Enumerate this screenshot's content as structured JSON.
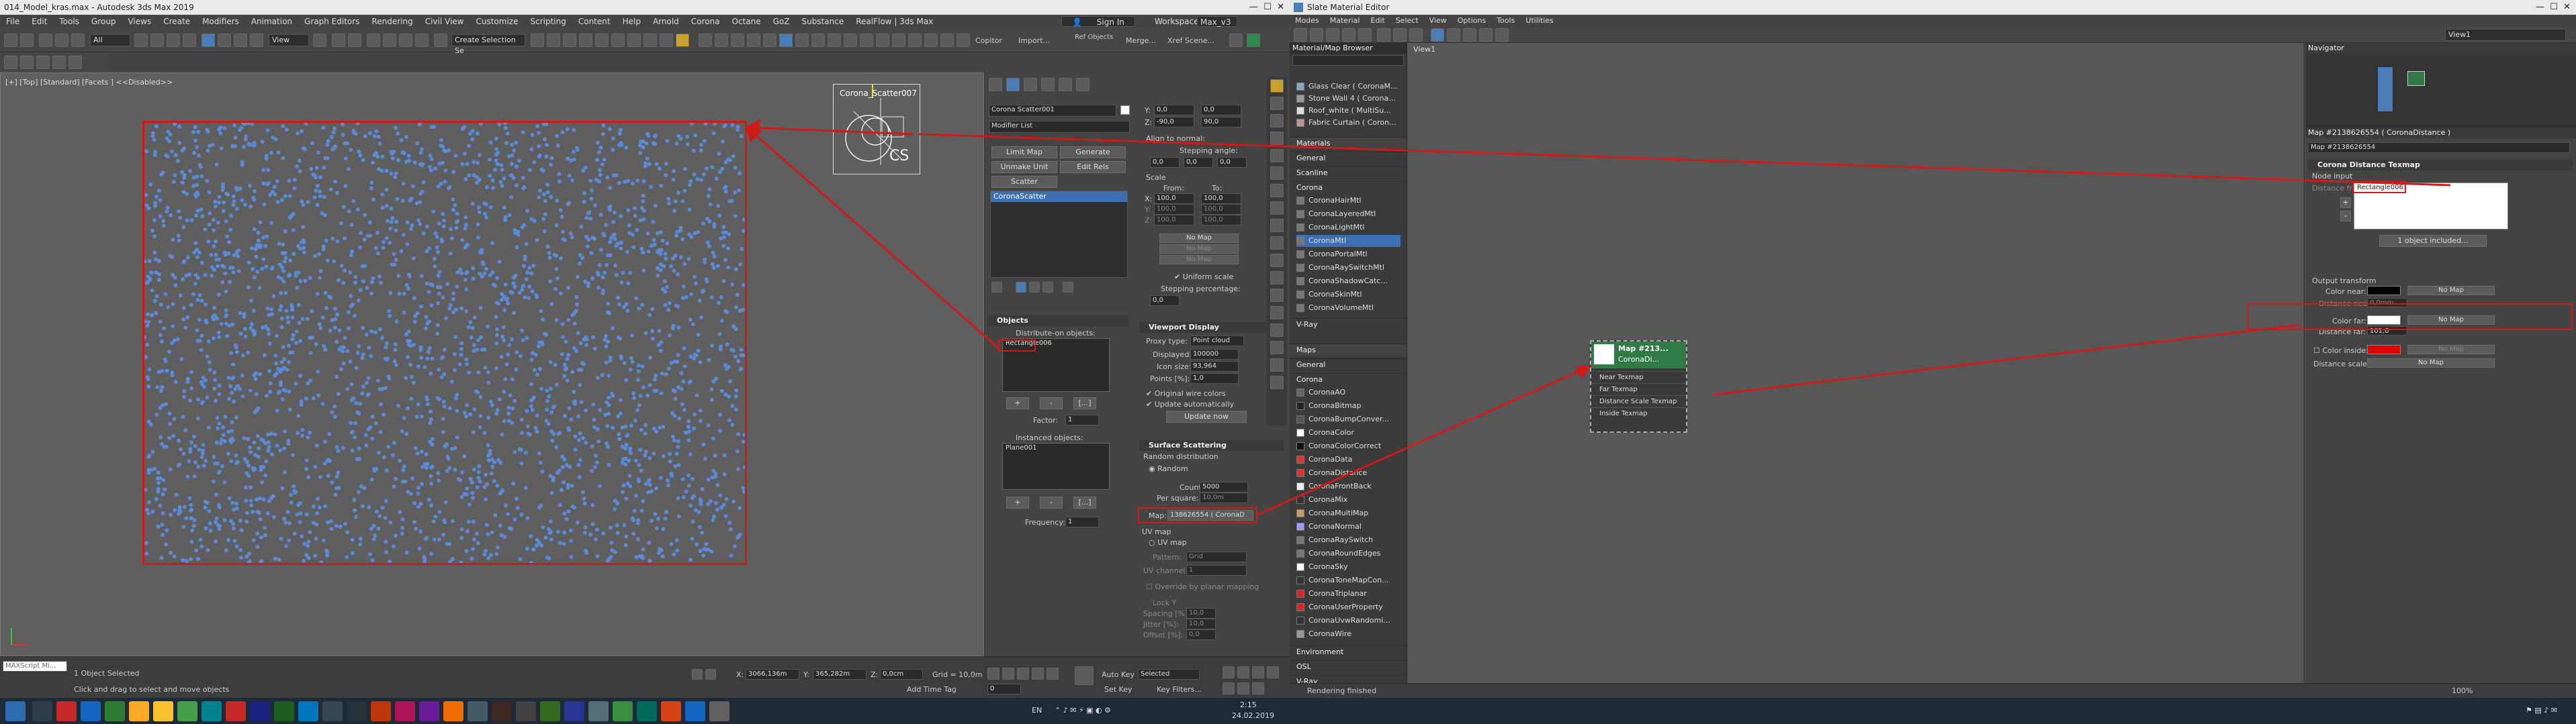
{
  "max": {
    "title": "014_Model_kras.max - Autodesk 3ds Max 2019",
    "menu": [
      "File",
      "Edit",
      "Tools",
      "Group",
      "Views",
      "Create",
      "Modifiers",
      "Animation",
      "Graph Editors",
      "Rendering",
      "Civil View",
      "Customize",
      "Scripting",
      "Content",
      "Help",
      "Arnold",
      "Corona",
      "Octane",
      "GoZ",
      "Substance",
      "RealFlow | 3ds Max"
    ],
    "sign_in": "Sign In",
    "workspaces_label": "Workspaces:",
    "workspaces_value": "Max_v3",
    "toolbar_selection_set": "Create Selection Se",
    "toolbar_view": "View",
    "toolbar_all": "All",
    "toolbar_copitor": "Copitor",
    "toolbar_import": "Import...",
    "toolbar_ref_objects": "Ref Objects",
    "toolbar_merge": "Merge...",
    "toolbar_xref": "Xref Scene...",
    "viewport_label": "[+] [Top] [Standard] [Facets ] <<Disabled>>",
    "gizmo_label": "Corona_Scatter007",
    "gizmo_cs": "CS",
    "cmd": {
      "object_name": "Corona Scatter001",
      "modifier_list": "Modifier List",
      "stack_item": "CoronaScatter",
      "btns": [
        "Limit Map",
        "Generate",
        "Unmake Unit",
        "Edit Rels",
        "Scatter"
      ],
      "objects_title": "Objects",
      "distribute_on": "Distribute-on objects:",
      "distribute_item": "Rectangle006",
      "factor_label": "Factor:",
      "factor_value": "1",
      "instanced_label": "Instanced objects:",
      "instanced_item": "Plane001",
      "frequency_label": "Frequency:",
      "frequency_value": "1",
      "plus": "+",
      "minus": "-",
      "dots": "[...]",
      "transform": {
        "y1": "0,0",
        "y1b": "0,0",
        "z1": "-90,0",
        "z1b": "90,0",
        "align_normal": "Align to normal:",
        "align_value": "0,0",
        "stepping_angle": "Stepping angle:",
        "stepping_vals": [
          "0,0",
          "0,0",
          "0,0"
        ],
        "scale": "Scale",
        "from": "From:",
        "to": "To:",
        "x_from": "100,0",
        "x_to": "100,0",
        "y_from": "100,0",
        "y_to": "100,0",
        "z_from": "100,0",
        "z_to": "100,0",
        "no_map": "No Map",
        "uniform_scale": "Uniform scale",
        "stepping_percentage": "Stepping percentage:",
        "stepping_pct_val": "0,0"
      },
      "viewport_display": {
        "title": "Viewport Display",
        "proxy_type_label": "Proxy type:",
        "proxy_type": "Point cloud",
        "displayed_label": "Displayed:",
        "displayed": "100000",
        "icon_size_label": "Icon size:",
        "icon_size": "93,964",
        "points_label": "Points [%]:",
        "points": "1,0",
        "original_wire": "Original wire colors",
        "update_auto": "Update automatically",
        "update_now": "Update now"
      },
      "surface": {
        "title": "Surface Scattering",
        "random_distribution": "Random distribution",
        "random": "Random",
        "count_label": "Count:",
        "count": "5000",
        "per_square_label": "Per square:",
        "per_square": "10,0m",
        "map_label": "Map:",
        "map_value": "138626554 ( CoronaD",
        "uv_map": "UV map",
        "uv_map_chk": "UV map",
        "pattern_label": "Pattern:",
        "pattern": "Grid",
        "uv_channel_label": "UV channel:",
        "uv_channel": "1",
        "override_planar": "Override by planar mapping",
        "lock_label": "Lock Y",
        "spacing_label": "Spacing [%]:",
        "jitter_label": "Jitter [%]:",
        "offset_label": "Offset [%]:",
        "uv_vals": [
          "10,0",
          "10,0",
          "0,0"
        ]
      }
    },
    "status": {
      "script_placeholder": "MAXScript Mi...",
      "objects_selected": "1 Object Selected",
      "hint": "Click and drag to select and move objects",
      "x_label": "X:",
      "x": "3066,136m",
      "y_label": "Y:",
      "y": "365,282m",
      "z_label": "Z:",
      "z": "0,0cm",
      "grid": "Grid = 10,0m",
      "add_time_tag": "Add Time Tag",
      "auto_key": "Auto Key",
      "selected": "Selected",
      "set_key": "Set Key",
      "key_filters": "Key Filters...",
      "frame": "0"
    }
  },
  "slate": {
    "title": "Slate Material Editor",
    "menu": [
      "Modes",
      "Material",
      "Edit",
      "Select",
      "View",
      "Options",
      "Tools",
      "Utilities"
    ],
    "browser_title": "Material/Map Browser",
    "top_items": [
      "Glass Clear ( CoronaM...",
      "Stone Wall 4 ( Corona...",
      "Roof_white ( MultiSu...",
      "Fabric Curtain ( Coron..."
    ],
    "materials_header": "Materials",
    "general": "General",
    "scanline": "Scanline",
    "corona": "Corona",
    "corona_materials": [
      "CoronaHairMtl",
      "CoronaLayeredMtl",
      "CoronaLightMtl",
      "CoronaMtl",
      "CoronaPortalMtl",
      "CoronaRaySwitchMtl",
      "CoronaShadowCatc...",
      "CoronaSkinMtl",
      "CoronaVolumeMtl"
    ],
    "vray": "V-Ray",
    "maps_header": "Maps",
    "maps_general": "General",
    "maps_corona": "Corona",
    "corona_maps": [
      "CoronaAO",
      "CoronaBitmap",
      "CoronaBumpConver...",
      "CoronaColor",
      "CoronaColorCorrect",
      "CoronaData",
      "CoronaDistance",
      "CoronaFrontBack",
      "CoronaMix",
      "CoronaMultiMap",
      "CoronaNormal",
      "CoronaRaySwitch",
      "CoronaRoundEdges",
      "CoronaSky",
      "CoronaToneMapCon...",
      "CoronaTriplanar",
      "CoronaUserProperty",
      "CoronaUvwRandomi...",
      "CoronaWire"
    ],
    "environment": "Environment",
    "osl": "OSL",
    "maps_vray": "V-Ray",
    "view_tab": "View1",
    "view_dropdown": "View1",
    "node": {
      "title": "Map #213...",
      "subtitle": "CoronaDi...",
      "slots": [
        "Near Texmap",
        "Far Texmap",
        "Distance Scale Texmap",
        "Inside Texmap"
      ]
    },
    "navigator": "Navigator",
    "param": {
      "header": "Map #2138626554  ( CoronaDistance )",
      "name_field": "Map #2138626554",
      "rollout": "Corona Distance Texmap",
      "node_input": "Node input",
      "distance_from": "Distance from:",
      "listed_object": "Rectangle006",
      "objects_included": "1 object included...",
      "output_transform": "Output transform",
      "color_near_label": "Color near:",
      "distance_near_label": "Distance near:",
      "distance_near": "0,0mm",
      "color_far_label": "Color far:",
      "distance_far_label": "Distance far:",
      "distance_far": "101,0",
      "color_inside_label": "Color inside:",
      "distance_scale_label": "Distance scale:",
      "no_map": "No Map",
      "plus": "+",
      "minus": "-"
    },
    "status": "Rendering finished",
    "zoom": "100%"
  },
  "taskbar": {
    "lang": "EN",
    "time": "2:15",
    "date": "24.02.2019"
  },
  "colors": {
    "dot_blue": "#5b8ad6",
    "annotation_red": "#d01a1a",
    "node_green": "#2f7a45",
    "selection_blue": "#3d6fb5",
    "color_near": "#000000",
    "color_far": "#ffffff",
    "color_inside": "#e00000"
  }
}
